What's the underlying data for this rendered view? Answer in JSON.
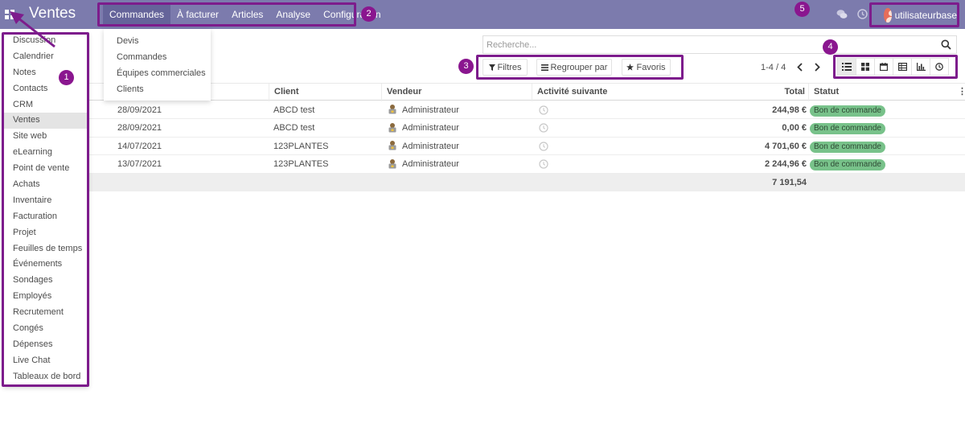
{
  "navbar": {
    "app_title": "Ventes",
    "menu": [
      "Commandes",
      "À facturer",
      "Articles",
      "Analyse",
      "Configuration"
    ],
    "active_menu": "Commandes",
    "user_name": "utilisateurbase",
    "bg_color": "#7c7bad"
  },
  "apps_menu": {
    "items": [
      "Discussion",
      "Calendrier",
      "Notes",
      "Contacts",
      "CRM",
      "Ventes",
      "Site web",
      "eLearning",
      "Point de vente",
      "Achats",
      "Inventaire",
      "Facturation",
      "Projet",
      "Feuilles de temps",
      "Événements",
      "Sondages",
      "Employés",
      "Recrutement",
      "Congés",
      "Dépenses",
      "Live Chat",
      "Tableaux de bord"
    ],
    "active": "Ventes"
  },
  "submenu": {
    "items": [
      "Devis",
      "Commandes",
      "Équipes commerciales",
      "Clients"
    ]
  },
  "search": {
    "placeholder": "Recherche..."
  },
  "control_panel": {
    "filters_label": "Filtres",
    "group_by_label": "Regrouper par",
    "favorites_label": "Favoris",
    "pager": "1-4 / 4",
    "views": [
      "list",
      "kanban",
      "calendar",
      "pivot",
      "graph",
      "activity"
    ],
    "active_view": "list"
  },
  "table": {
    "headers": {
      "client": "Client",
      "salesperson": "Vendeur",
      "next_activity": "Activité suivante",
      "total": "Total",
      "status": "Statut"
    },
    "rows": [
      {
        "date": "28/09/2021",
        "client": "ABCD test",
        "salesperson": "Administrateur",
        "total": "244,98 €",
        "status": "Bon de commande"
      },
      {
        "date": "28/09/2021",
        "client": "ABCD test",
        "salesperson": "Administrateur",
        "total": "0,00 €",
        "status": "Bon de commande"
      },
      {
        "date": "14/07/2021",
        "client": "123PLANTES",
        "salesperson": "Administrateur",
        "total": "4 701,60 €",
        "status": "Bon de commande"
      },
      {
        "date": "13/07/2021",
        "client": "123PLANTES",
        "salesperson": "Administrateur",
        "total": "2 244,96 €",
        "status": "Bon de commande"
      }
    ],
    "sum_total": "7 191,54",
    "status_color": "#78c28a"
  },
  "annotations": {
    "labels": [
      "1",
      "2",
      "3",
      "4",
      "5"
    ],
    "color": "#8a168f"
  }
}
